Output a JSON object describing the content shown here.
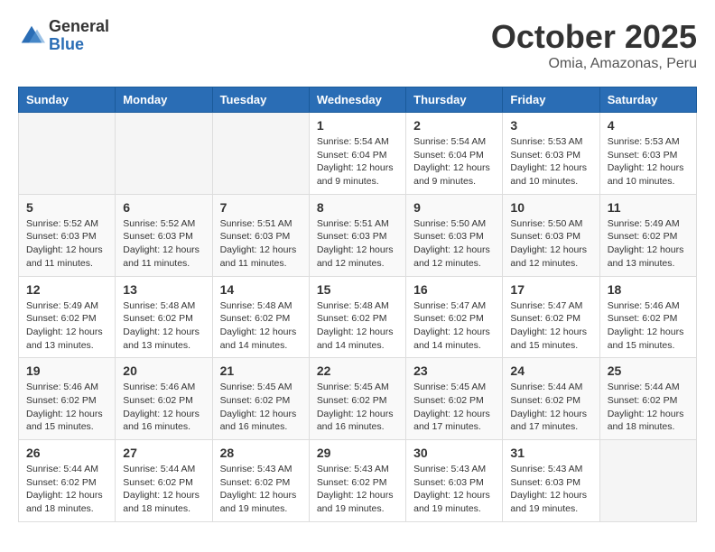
{
  "header": {
    "logo_general": "General",
    "logo_blue": "Blue",
    "month_title": "October 2025",
    "subtitle": "Omia, Amazonas, Peru"
  },
  "days_of_week": [
    "Sunday",
    "Monday",
    "Tuesday",
    "Wednesday",
    "Thursday",
    "Friday",
    "Saturday"
  ],
  "weeks": [
    [
      {
        "day": "",
        "info": ""
      },
      {
        "day": "",
        "info": ""
      },
      {
        "day": "",
        "info": ""
      },
      {
        "day": "1",
        "info": "Sunrise: 5:54 AM\nSunset: 6:04 PM\nDaylight: 12 hours and 9 minutes."
      },
      {
        "day": "2",
        "info": "Sunrise: 5:54 AM\nSunset: 6:04 PM\nDaylight: 12 hours and 9 minutes."
      },
      {
        "day": "3",
        "info": "Sunrise: 5:53 AM\nSunset: 6:03 PM\nDaylight: 12 hours and 10 minutes."
      },
      {
        "day": "4",
        "info": "Sunrise: 5:53 AM\nSunset: 6:03 PM\nDaylight: 12 hours and 10 minutes."
      }
    ],
    [
      {
        "day": "5",
        "info": "Sunrise: 5:52 AM\nSunset: 6:03 PM\nDaylight: 12 hours and 11 minutes."
      },
      {
        "day": "6",
        "info": "Sunrise: 5:52 AM\nSunset: 6:03 PM\nDaylight: 12 hours and 11 minutes."
      },
      {
        "day": "7",
        "info": "Sunrise: 5:51 AM\nSunset: 6:03 PM\nDaylight: 12 hours and 11 minutes."
      },
      {
        "day": "8",
        "info": "Sunrise: 5:51 AM\nSunset: 6:03 PM\nDaylight: 12 hours and 12 minutes."
      },
      {
        "day": "9",
        "info": "Sunrise: 5:50 AM\nSunset: 6:03 PM\nDaylight: 12 hours and 12 minutes."
      },
      {
        "day": "10",
        "info": "Sunrise: 5:50 AM\nSunset: 6:03 PM\nDaylight: 12 hours and 12 minutes."
      },
      {
        "day": "11",
        "info": "Sunrise: 5:49 AM\nSunset: 6:02 PM\nDaylight: 12 hours and 13 minutes."
      }
    ],
    [
      {
        "day": "12",
        "info": "Sunrise: 5:49 AM\nSunset: 6:02 PM\nDaylight: 12 hours and 13 minutes."
      },
      {
        "day": "13",
        "info": "Sunrise: 5:48 AM\nSunset: 6:02 PM\nDaylight: 12 hours and 13 minutes."
      },
      {
        "day": "14",
        "info": "Sunrise: 5:48 AM\nSunset: 6:02 PM\nDaylight: 12 hours and 14 minutes."
      },
      {
        "day": "15",
        "info": "Sunrise: 5:48 AM\nSunset: 6:02 PM\nDaylight: 12 hours and 14 minutes."
      },
      {
        "day": "16",
        "info": "Sunrise: 5:47 AM\nSunset: 6:02 PM\nDaylight: 12 hours and 14 minutes."
      },
      {
        "day": "17",
        "info": "Sunrise: 5:47 AM\nSunset: 6:02 PM\nDaylight: 12 hours and 15 minutes."
      },
      {
        "day": "18",
        "info": "Sunrise: 5:46 AM\nSunset: 6:02 PM\nDaylight: 12 hours and 15 minutes."
      }
    ],
    [
      {
        "day": "19",
        "info": "Sunrise: 5:46 AM\nSunset: 6:02 PM\nDaylight: 12 hours and 15 minutes."
      },
      {
        "day": "20",
        "info": "Sunrise: 5:46 AM\nSunset: 6:02 PM\nDaylight: 12 hours and 16 minutes."
      },
      {
        "day": "21",
        "info": "Sunrise: 5:45 AM\nSunset: 6:02 PM\nDaylight: 12 hours and 16 minutes."
      },
      {
        "day": "22",
        "info": "Sunrise: 5:45 AM\nSunset: 6:02 PM\nDaylight: 12 hours and 16 minutes."
      },
      {
        "day": "23",
        "info": "Sunrise: 5:45 AM\nSunset: 6:02 PM\nDaylight: 12 hours and 17 minutes."
      },
      {
        "day": "24",
        "info": "Sunrise: 5:44 AM\nSunset: 6:02 PM\nDaylight: 12 hours and 17 minutes."
      },
      {
        "day": "25",
        "info": "Sunrise: 5:44 AM\nSunset: 6:02 PM\nDaylight: 12 hours and 18 minutes."
      }
    ],
    [
      {
        "day": "26",
        "info": "Sunrise: 5:44 AM\nSunset: 6:02 PM\nDaylight: 12 hours and 18 minutes."
      },
      {
        "day": "27",
        "info": "Sunrise: 5:44 AM\nSunset: 6:02 PM\nDaylight: 12 hours and 18 minutes."
      },
      {
        "day": "28",
        "info": "Sunrise: 5:43 AM\nSunset: 6:02 PM\nDaylight: 12 hours and 19 minutes."
      },
      {
        "day": "29",
        "info": "Sunrise: 5:43 AM\nSunset: 6:02 PM\nDaylight: 12 hours and 19 minutes."
      },
      {
        "day": "30",
        "info": "Sunrise: 5:43 AM\nSunset: 6:03 PM\nDaylight: 12 hours and 19 minutes."
      },
      {
        "day": "31",
        "info": "Sunrise: 5:43 AM\nSunset: 6:03 PM\nDaylight: 12 hours and 19 minutes."
      },
      {
        "day": "",
        "info": ""
      }
    ]
  ]
}
